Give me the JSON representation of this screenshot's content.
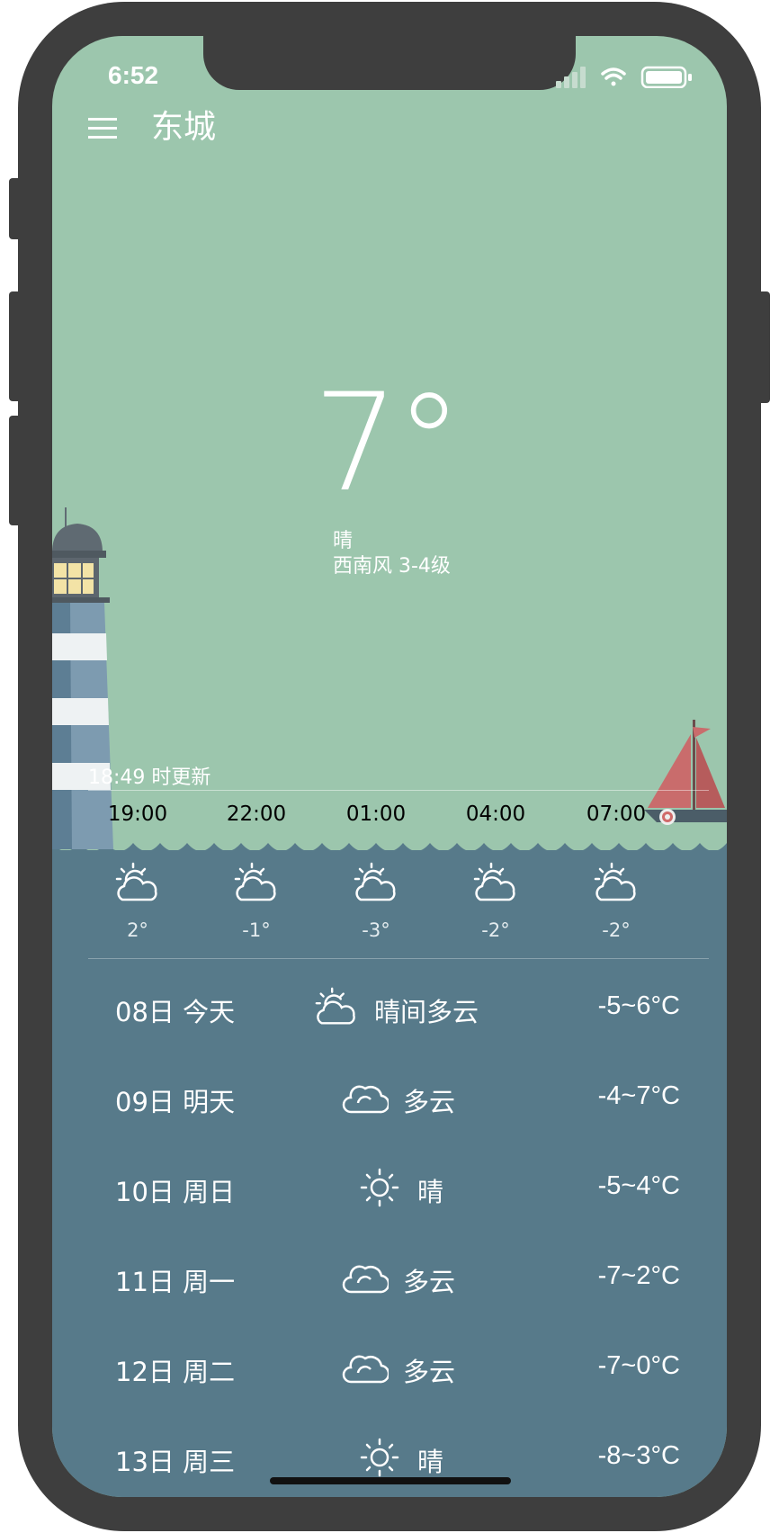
{
  "status": {
    "time": "6:52"
  },
  "header": {
    "city": "东城",
    "menu_icon": "menu-icon"
  },
  "current": {
    "temperature": "7°",
    "condition": "晴",
    "wind": "西南风 3-4级",
    "updated": "18:49 时更新"
  },
  "hourly": [
    {
      "time": "19:00",
      "temp": "2°",
      "icon": "partly-cloudy-icon"
    },
    {
      "time": "22:00",
      "temp": "-1°",
      "icon": "partly-cloudy-icon"
    },
    {
      "time": "01:00",
      "temp": "-3°",
      "icon": "partly-cloudy-icon"
    },
    {
      "time": "04:00",
      "temp": "-2°",
      "icon": "partly-cloudy-icon"
    },
    {
      "time": "07:00",
      "temp": "-2°",
      "icon": "partly-cloudy-icon"
    }
  ],
  "daily": [
    {
      "date": "08日  今天",
      "cond": "晴间多云",
      "range": "-5~6°C",
      "icon": "partly-cloudy-icon"
    },
    {
      "date": "09日  明天",
      "cond": "多云",
      "range": "-4~7°C",
      "icon": "cloud-icon"
    },
    {
      "date": "10日  周日",
      "cond": "晴",
      "range": "-5~4°C",
      "icon": "sun-icon"
    },
    {
      "date": "11日  周一",
      "cond": "多云",
      "range": "-7~2°C",
      "icon": "cloud-icon"
    },
    {
      "date": "12日  周二",
      "cond": "多云",
      "range": "-7~0°C",
      "icon": "cloud-icon"
    },
    {
      "date": "13日  周三",
      "cond": "晴",
      "range": "-8~3°C",
      "icon": "sun-icon"
    }
  ],
  "colors": {
    "sky": "#9cc6ad",
    "sea": "#577a8a",
    "frame": "#3e3e3e"
  }
}
